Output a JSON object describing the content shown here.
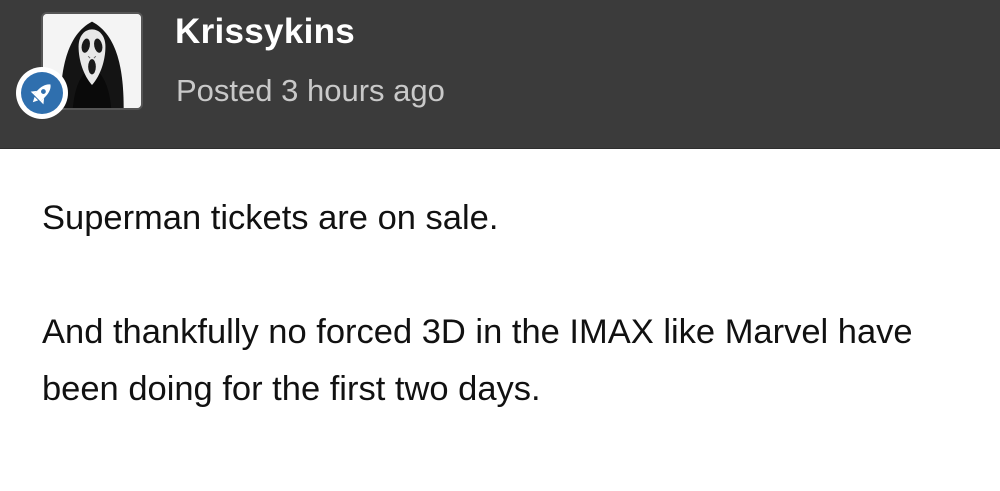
{
  "post": {
    "author": {
      "name": "Krissykins",
      "avatar_icon": "ghostface-mask-avatar",
      "badge_icon": "rocket-icon",
      "badge_color": "#2f6fae"
    },
    "posted_label": "Posted 3 hours ago",
    "header_background": "#3b3b3b",
    "body": [
      "Superman tickets are on sale.",
      "And thankfully no forced 3D in the IMAX like Marvel have been doing for the first two days."
    ]
  }
}
